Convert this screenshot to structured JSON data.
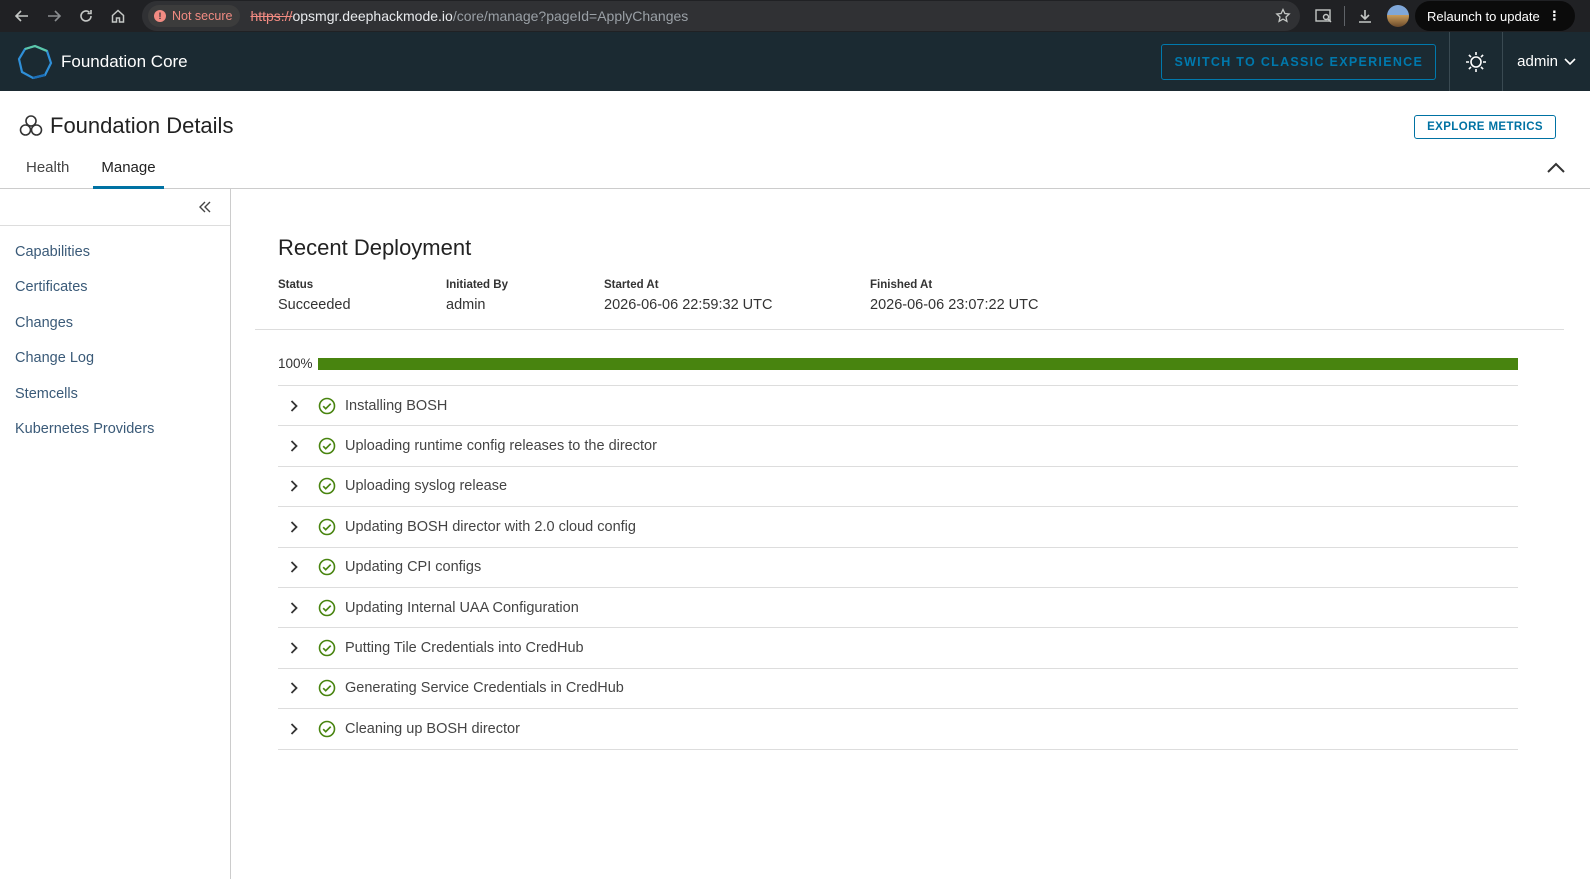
{
  "browser": {
    "not_secure_label": "Not secure",
    "url_scheme": "https://",
    "url_host": "opsmgr.deephackmode.io",
    "url_path": "/core/manage?pageId=ApplyChanges",
    "relaunch_label": "Relaunch to update"
  },
  "header": {
    "app_title": "Foundation Core",
    "classic_button": "SWITCH TO CLASSIC EXPERIENCE",
    "user": "admin"
  },
  "page": {
    "title": "Foundation Details",
    "explore_button": "EXPLORE METRICS",
    "tabs": [
      {
        "label": "Health"
      },
      {
        "label": "Manage"
      }
    ]
  },
  "sidebar": {
    "items": [
      {
        "label": "Capabilities"
      },
      {
        "label": "Certificates"
      },
      {
        "label": "Changes"
      },
      {
        "label": "Change Log"
      },
      {
        "label": "Stemcells"
      },
      {
        "label": "Kubernetes Providers"
      }
    ]
  },
  "deployment": {
    "title": "Recent Deployment",
    "meta": [
      {
        "label": "Status",
        "value": "Succeeded"
      },
      {
        "label": "Initiated By",
        "value": "admin"
      },
      {
        "label": "Started At",
        "value": "2026-06-06 22:59:32 UTC"
      },
      {
        "label": "Finished At",
        "value": "2026-06-06 23:07:22 UTC"
      }
    ],
    "progress_label": "100%",
    "progress_fraction": 1.0,
    "progress_color": "#48840f",
    "steps": [
      {
        "label": "Installing BOSH"
      },
      {
        "label": "Uploading runtime config releases to the director"
      },
      {
        "label": "Uploading syslog release"
      },
      {
        "label": "Updating BOSH director with 2.0 cloud config"
      },
      {
        "label": "Updating CPI configs"
      },
      {
        "label": "Updating Internal UAA Configuration"
      },
      {
        "label": "Putting Tile Credentials into CredHub"
      },
      {
        "label": "Generating Service Credentials in CredHub"
      },
      {
        "label": "Cleaning up BOSH director"
      }
    ]
  },
  "icons": {
    "step_status": "check-circle-icon",
    "step_expand": "chevron-right-icon"
  }
}
